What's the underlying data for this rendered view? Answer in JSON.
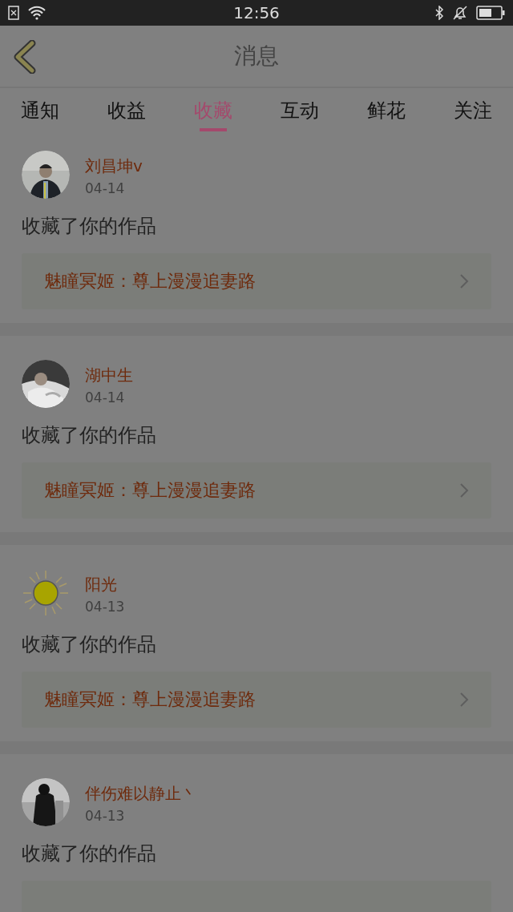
{
  "status_bar": {
    "time": "12:56"
  },
  "header": {
    "title": "消息"
  },
  "tabs": [
    {
      "label": "通知",
      "selected": false
    },
    {
      "label": "收益",
      "selected": false
    },
    {
      "label": "收藏",
      "selected": true
    },
    {
      "label": "互动",
      "selected": false
    },
    {
      "label": "鲜花",
      "selected": false
    },
    {
      "label": "关注",
      "selected": false
    }
  ],
  "messages": [
    {
      "user": "刘昌坤v",
      "date": "04-14",
      "action": "收藏了你的作品",
      "work": "魅瞳冥姬：尊上漫漫追妻路"
    },
    {
      "user": "湖中生",
      "date": "04-14",
      "action": "收藏了你的作品",
      "work": "魅瞳冥姬：尊上漫漫追妻路"
    },
    {
      "user": "阳光",
      "date": "04-13",
      "action": "收藏了你的作品",
      "work": "魅瞳冥姬：尊上漫漫追妻路"
    },
    {
      "user": "伴伤难以静止丶",
      "date": "04-13",
      "action": "收藏了你的作品"
    }
  ]
}
